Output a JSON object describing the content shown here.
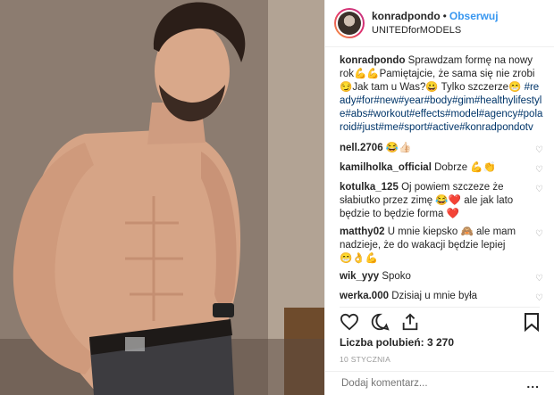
{
  "header": {
    "username": "konradpondo",
    "separator": "•",
    "follow_label": "Obserwuj",
    "subtitle": "UNITEDforMODELS"
  },
  "caption": {
    "username": "konradpondo",
    "text": "Sprawdzam formę na nowy rok💪💪Pamiętajcie, że sama się nie zrobi😏Jak tam u Was?😀 Tylko szczerze😁",
    "hashtags": "#ready#for#new#year#body#gim#healthylifestyle#abs#workout#effects#model#agency#polaroid#just#me#sport#active#konradpondotv"
  },
  "comments": [
    {
      "user": "nell.2706",
      "text": "😂👍🏻"
    },
    {
      "user": "kamilholka_official",
      "text": "Dobrze 💪👏"
    },
    {
      "user": "kotulka_125",
      "text": "Oj powiem szczeze że słabiutko przez zimę 😂❤️ ale jak lato będzie to będzie forma ❤️"
    },
    {
      "user": "matthy02",
      "text": "U mnie kiepsko 🙈 ale mam nadzieje, że do wakacji będzie lepiej 😁👌💪"
    },
    {
      "user": "wik_yyy",
      "text": "Spoko"
    },
    {
      "user": "werka.000",
      "text": "Dzisiaj u mnie była siatkówka 🏐Jest dobrze 👍"
    }
  ],
  "likes": {
    "label": "Liczba polubień: 3 270"
  },
  "date": "10 STYCZNIA",
  "comment_input": {
    "placeholder": "Dodaj komentarz...",
    "more": "..."
  },
  "icons": {
    "like": "heart-icon",
    "comment": "comment-icon",
    "share": "share-icon",
    "save": "bookmark-icon",
    "comment_like": "small-heart-icon"
  },
  "colors": {
    "link": "#3897f0",
    "hashtag": "#003569",
    "muted": "#999999"
  }
}
